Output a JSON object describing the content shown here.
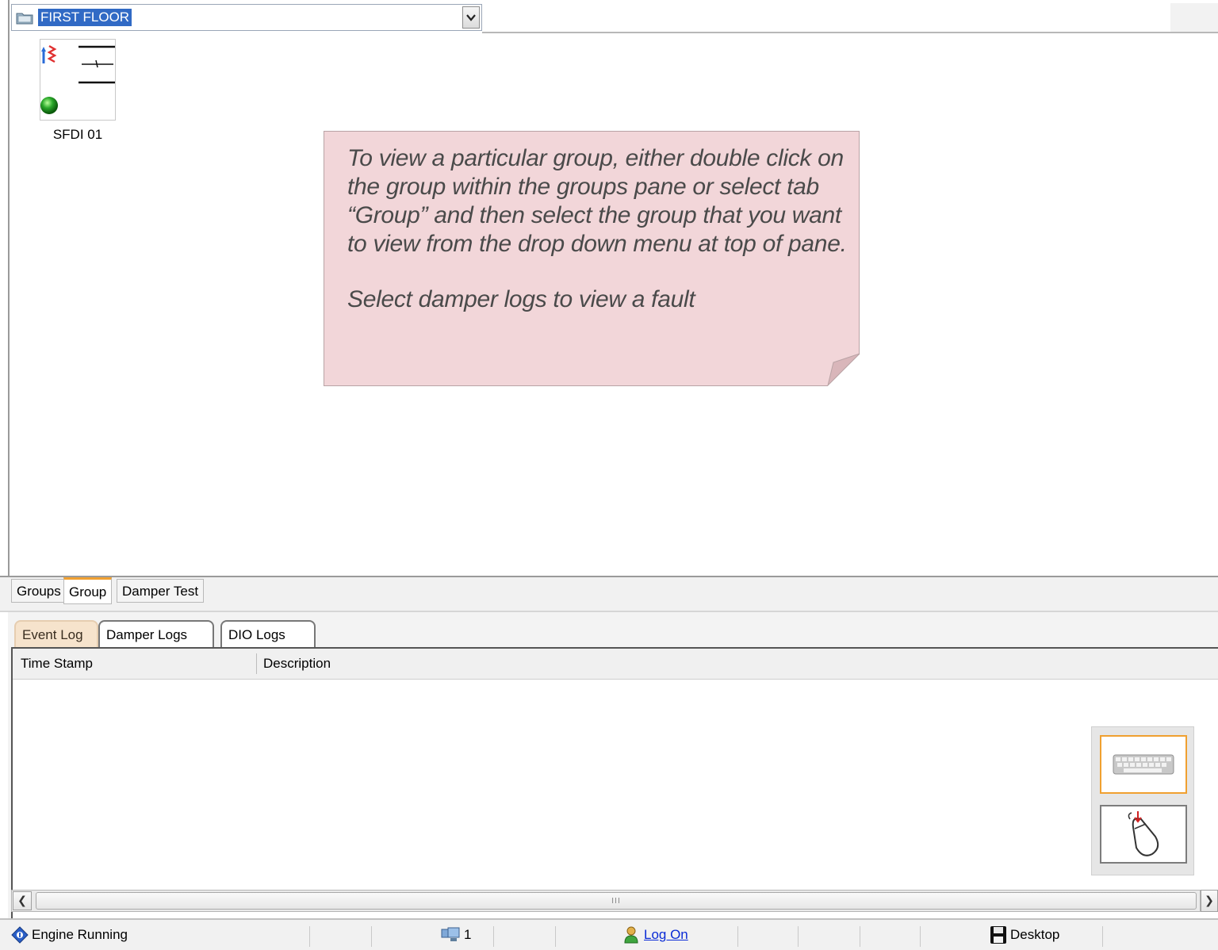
{
  "group_selector": {
    "selected": "FIRST FLOOR"
  },
  "device": {
    "label": "SFDI 01",
    "status_color": "#22aa22"
  },
  "callout": {
    "paragraph1": "To view a particular group, either double click on the group within the groups pane or select tab “Group” and then select the group that you want to view from the drop down menu at top of pane.",
    "paragraph2": "Select damper logs to view a fault"
  },
  "view_tabs": [
    {
      "label": "Groups"
    },
    {
      "label": "Group",
      "active": true
    },
    {
      "label": "Damper Test"
    }
  ],
  "log_tabs": [
    {
      "label": "Event Log",
      "active": true
    },
    {
      "label": "Damper Logs"
    },
    {
      "label": "DIO Logs"
    }
  ],
  "log_table": {
    "columns": [
      "Time Stamp",
      "Description"
    ],
    "rows": []
  },
  "scrollbar": {
    "thumb_grip": "III"
  },
  "tools": {
    "keyboard": "keyboard-icon",
    "mouse": "mouse-icon"
  },
  "status_bar": {
    "engine": "Engine Running",
    "count": "1",
    "logon": "Log On",
    "desktop": "Desktop"
  },
  "colors": {
    "accent": "#f0a030",
    "selection": "#316ac5",
    "note_bg": "#f2d6d9",
    "link": "#0a2bd6"
  }
}
